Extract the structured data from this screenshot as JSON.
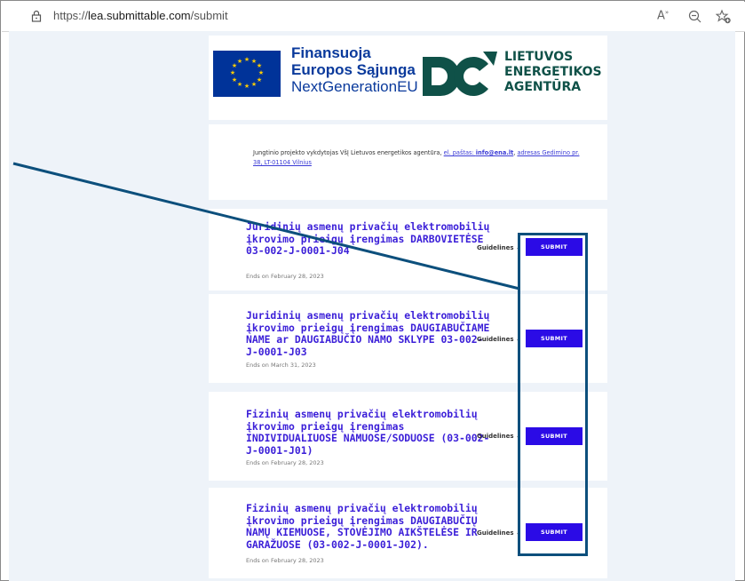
{
  "browser": {
    "url_prefix": "https://",
    "url_host": "lea.submittable.com",
    "url_path": "/submit",
    "read_aloud_icon": "read-aloud-icon",
    "zoom_icon": "zoom-icon",
    "favorite_icon": "add-favorite-icon"
  },
  "logo": {
    "eu_line1": "Finansuoja",
    "eu_line2": "Europos Sąjunga",
    "eu_line3": "NextGenerationEU",
    "agency_line1": "LIETUVOS",
    "agency_line2": "ENERGETIKOS",
    "agency_line3": "AGENTŪRA",
    "eu_blue": "#003399",
    "eu_star": "#ffcc00",
    "agency_green": "#0f5148"
  },
  "info": {
    "text_before": "Jungtinio projekto vykdytojas VšĮ Lietuvos energetikos agentūra, ",
    "email_label": "el. paštas: ",
    "email": "info@ena.lt",
    "sep": ", ",
    "address_label": "adresas",
    "address": "Gedimino pr. 38, LT-01104 Vilnius"
  },
  "opportunities": [
    {
      "title": "Juridinių asmenų privačių elektromobilių įkrovimo prieigų įrengimas DARBOVIETĖSE 03-002-J-0001-J04",
      "ends": "Ends on February 28, 2023",
      "guidelines": "Guidelines",
      "submit": "SUBMIT"
    },
    {
      "title": "Juridinių asmenų privačių elektromobilių įkrovimo prieigų įrengimas DAUGIABUČIAME NAME ar DAUGIABUČIO NAMO SKLYPE 03-002-J-0001-J03",
      "ends": "Ends on March 31, 2023",
      "guidelines": "Guidelines",
      "submit": "SUBMIT"
    },
    {
      "title": "Fizinių asmenų privačių elektromobilių įkrovimo prieigų įrengimas INDIVIDUALIUOSE NAMUOSE/SODUOSE (03-002-J-0001-J01)",
      "ends": "Ends on February 28, 2023",
      "guidelines": "Guidelines",
      "submit": "SUBMIT"
    },
    {
      "title": "Fizinių asmenų privačių elektromobilių įkrovimo prieigų įrengimas DAUGIABUČIŲ NAMŲ KIEMUOSE, STOVĖJIMO AIKŠTELĖSE IR GARAŽUOSE (03-002-J-0001-J02).",
      "ends": "Ends on February 28, 2023",
      "guidelines": "Guidelines",
      "submit": "SUBMIT"
    }
  ],
  "annotation": {
    "color": "#0c4f7c"
  }
}
